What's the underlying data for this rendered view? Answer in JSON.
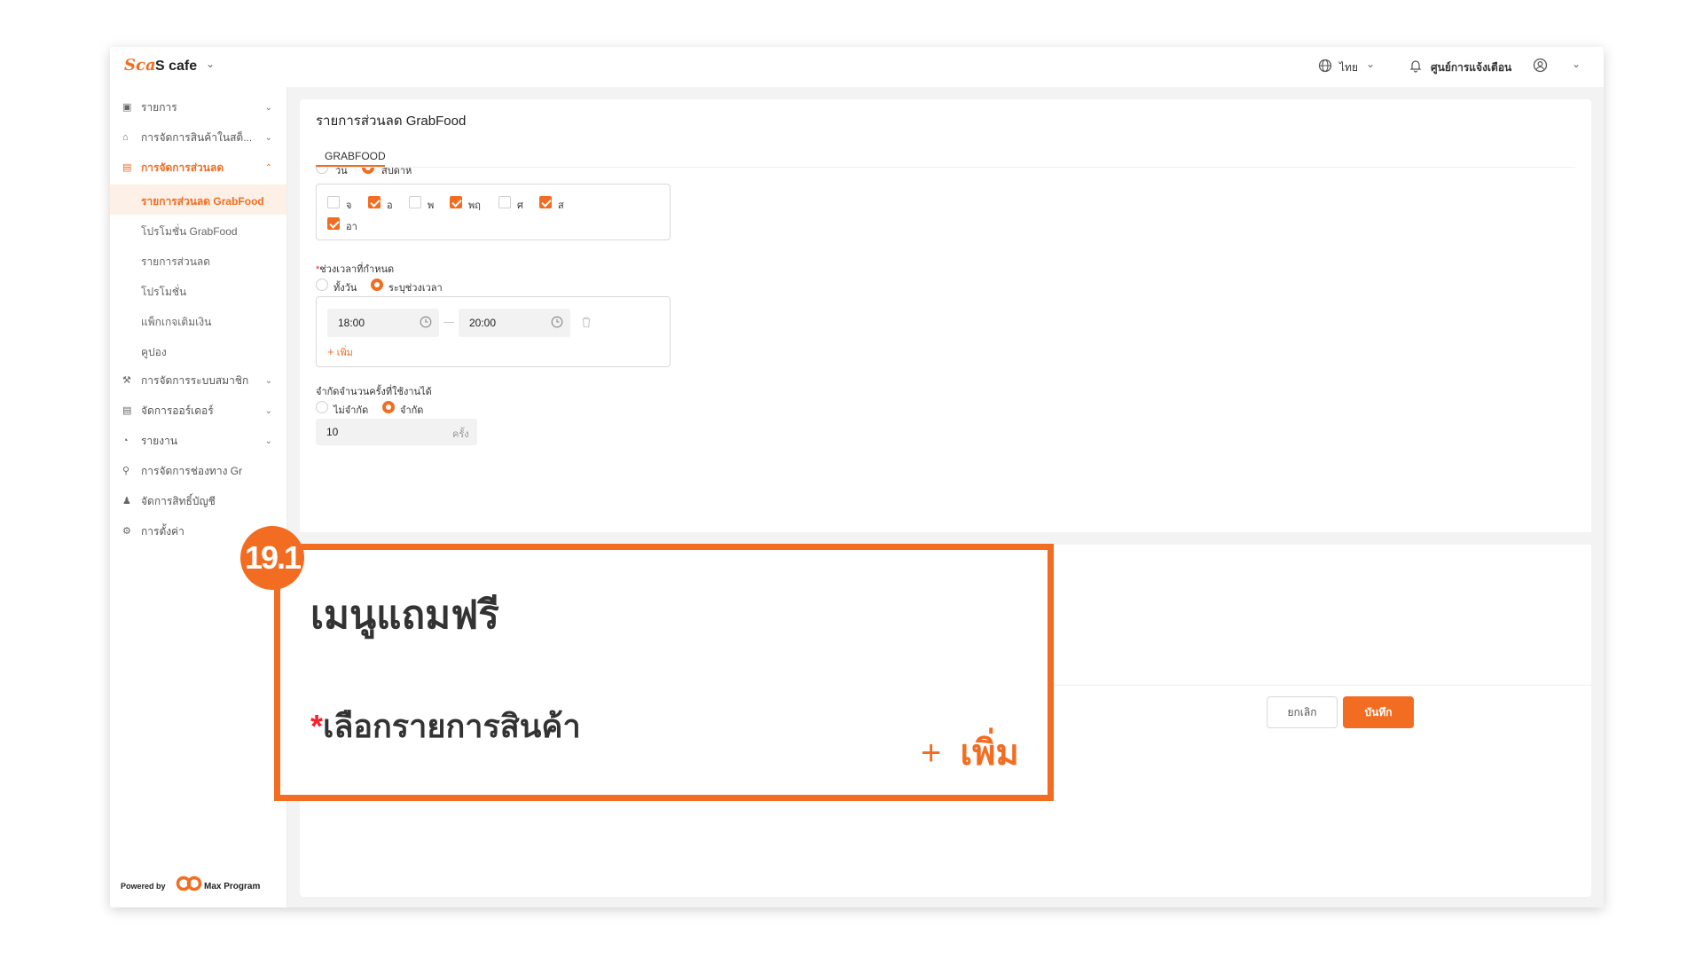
{
  "app": {
    "brand_logo_text": "Sca",
    "brand_name": "S cafe"
  },
  "header": {
    "language": "ไทย",
    "notification_center": "ศูนย์การแจ้งเตือน"
  },
  "sidebar": {
    "items": [
      {
        "label": "รายการ",
        "icon": "list-icon"
      },
      {
        "label": "การจัดการสินค้าในสต็...",
        "icon": "store-icon"
      },
      {
        "label": "การจัดการส่วนลด",
        "icon": "discount-icon"
      },
      {
        "label": "การจัดการระบบสมาชิก",
        "icon": "member-icon"
      },
      {
        "label": "จัดการออร์เดอร์",
        "icon": "order-icon"
      },
      {
        "label": "รายงาน",
        "icon": "report-icon"
      },
      {
        "label": "การจัดการช่องทาง Gr",
        "icon": "channel-icon"
      },
      {
        "label": "จัดการสิทธิ์บัญชี",
        "icon": "users-icon"
      },
      {
        "label": "การตั้งค่า",
        "icon": "settings-icon"
      }
    ],
    "subitems": [
      {
        "label": "รายการส่วนลด GrabFood"
      },
      {
        "label": "โปรโมชั่น GrabFood"
      },
      {
        "label": "รายการส่วนลด"
      },
      {
        "label": "โปรโมชั่น"
      },
      {
        "label": "แพ็กเกจเติมเงิน"
      },
      {
        "label": "คูปอง"
      }
    ],
    "powered_by": "Powered by",
    "program_name": "Max Program"
  },
  "page": {
    "title": "รายการส่วนลด GrabFood",
    "tab": "GRABFOOD"
  },
  "form": {
    "day_mode_options": [
      "วัน",
      "สัปดาห์"
    ],
    "days": [
      {
        "label": "จ",
        "checked": false
      },
      {
        "label": "อ",
        "checked": true
      },
      {
        "label": "พ",
        "checked": false
      },
      {
        "label": "พฤ",
        "checked": true
      },
      {
        "label": "ศ",
        "checked": false
      },
      {
        "label": "ส",
        "checked": true
      },
      {
        "label": "อา",
        "checked": true
      }
    ],
    "time_label": "ช่วงเวลาที่กำหนด",
    "time_options": [
      "ทั้งวัน",
      "ระบุช่วงเวลา"
    ],
    "start_time": "18:00",
    "end_time": "20:00",
    "add_label": "เพิ่ม",
    "limit_label": "จำกัดจำนวนครั้งที่ใช้งานได้",
    "limit_options": [
      "ไม่จำกัด",
      "จำกัด"
    ],
    "limit_value": "10",
    "limit_unit": "ครั้ง"
  },
  "callout": {
    "badge": "19.1",
    "title": "เมนูแถมฟรี",
    "select_label": "เลือกรายการสินค้า",
    "add_label": "เพิ่ม"
  },
  "actions": {
    "cancel": "ยกเลิก",
    "save": "บันทึก"
  },
  "colors": {
    "accent": "#f26d21"
  }
}
